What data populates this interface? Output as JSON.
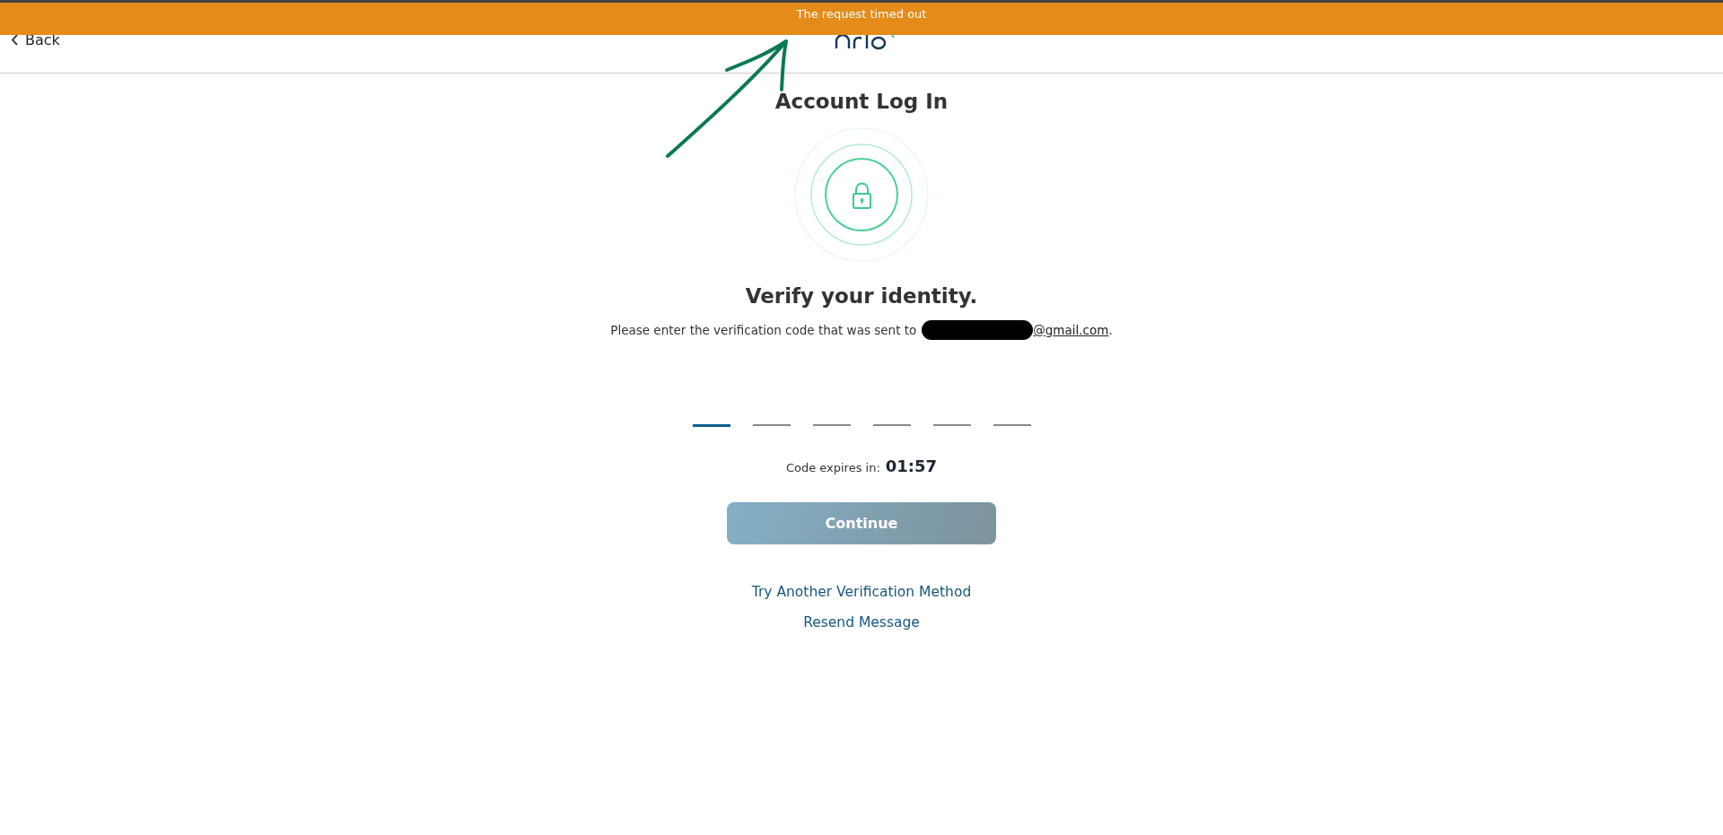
{
  "banner": {
    "message": "The request timed out"
  },
  "header": {
    "back": "Back"
  },
  "title": "Account Log In",
  "heading": "Verify your identity.",
  "message": {
    "text": "Please enter the verification code that was sent to",
    "email": "@gmail.com",
    "end": "."
  },
  "code_slots": [
    {
      "selected": true
    },
    {
      "selected": false
    },
    {
      "selected": false
    },
    {
      "selected": false
    },
    {
      "selected": false
    },
    {
      "selected": false
    }
  ],
  "timer": {
    "label": "Code expires in:",
    "value": "01:57"
  },
  "continue_button": {
    "label": "Continue",
    "disabled": true
  },
  "links": [
    "Try Another Verification Method",
    "Resend Message"
  ]
}
